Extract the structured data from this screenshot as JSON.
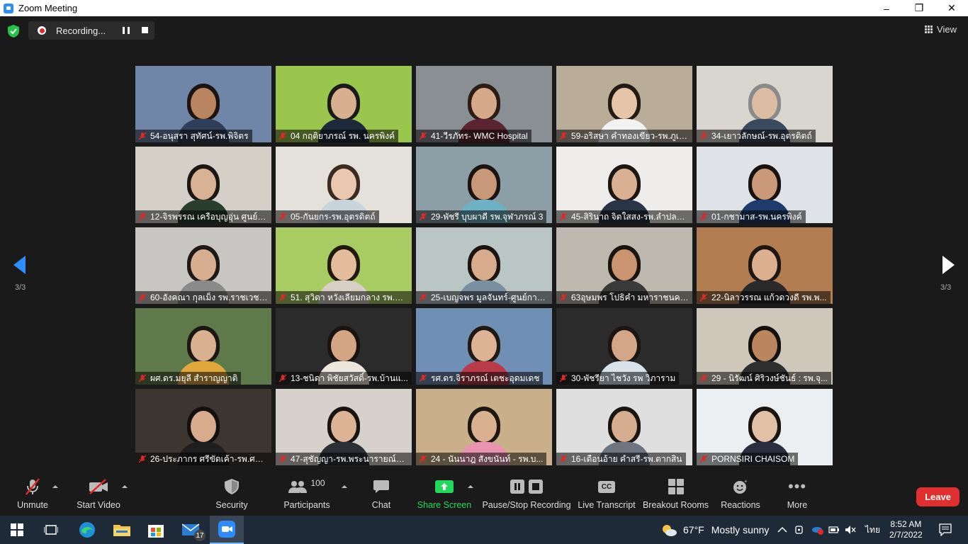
{
  "window": {
    "title": "Zoom Meeting"
  },
  "recording": {
    "status": "Recording..."
  },
  "view": {
    "label": "View"
  },
  "pagination": {
    "left": "3/3",
    "right": "3/3"
  },
  "participants_grid": [
    {
      "name": "54-อนุสรา สุทัศน์-รพ.พิจิตร",
      "bg": "#6f86a8",
      "skin": "#b98560",
      "hair": "#1c1410",
      "shirt": "#2f3e5a"
    },
    {
      "name": "04 กฤติยาภรณ์ รพ. นครพิงค์",
      "bg": "#9bc64e",
      "skin": "#d8b090",
      "hair": "#1a1a1a",
      "shirt": "#1e2a3a"
    },
    {
      "name": "41-วีรภัทร- WMC Hospital",
      "bg": "#8a8f94",
      "skin": "#d6a98a",
      "hair": "#2b1d16",
      "shirt": "#5a2430"
    },
    {
      "name": "59-อริสษา คำทองเขียว-รพ.ภูเขี...",
      "bg": "#b9ad9a",
      "skin": "#e6c4a8",
      "hair": "#241a14",
      "shirt": "#f2f2f2"
    },
    {
      "name": "34-เยาวลักษณ์-รพ.อุตรดิตถ์",
      "bg": "#d8d6cf",
      "skin": "#dcbca2",
      "hair": "#8a8a8a",
      "shirt": "#3a4a5e"
    },
    {
      "name": "12-จิรพรรณ เครือบุญอุ่น ศูนย์ส...",
      "bg": "#d4d0c8",
      "skin": "#d9b296",
      "hair": "#1b1613",
      "shirt": "#2a3e2e"
    },
    {
      "name": "05-กันยกร-รพ.อุตรดิตถ์",
      "bg": "#e4e0da",
      "skin": "#eac8b0",
      "hair": "#3a2a20",
      "shirt": "#c9d3dc"
    },
    {
      "name": "29-พัชรี บุบผาดี รพ.จุฬาภรณ์ 3",
      "bg": "#8c9fa6",
      "skin": "#c9987a",
      "hair": "#1a1410",
      "shirt": "#6fb1c4"
    },
    {
      "name": "45-สิรินาถ จิตใสสง-รพ.ลำปลาย...",
      "bg": "#eeedeb",
      "skin": "#d9b092",
      "hair": "#1c1511",
      "shirt": "#2a3447"
    },
    {
      "name": "01-กชามาส-รพ.นครพิงค์",
      "bg": "#dfe2e6",
      "skin": "#c9997a",
      "hair": "#17120f",
      "shirt": "#1d3b6c"
    },
    {
      "name": "60-อังคณา กุลเม็ง รพ.ราชเวชเ...",
      "bg": "#c8c6c2",
      "skin": "#d8ae90",
      "hair": "#1f1915",
      "shirt": "#8a8a8a"
    },
    {
      "name": "51. สุวิดา หวังเลียมกลาง รพ.กำ...",
      "bg": "#a9cc62",
      "skin": "#e3bc9c",
      "hair": "#22190f",
      "shirt": "#d8d0c4"
    },
    {
      "name": "25-เบญจพร มูลจันทร์-ศูนย์การ...",
      "bg": "#b9c6c4",
      "skin": "#d7ab8b",
      "hair": "#1c1410",
      "shirt": "#7a8fa0"
    },
    {
      "name": "63อุษมพร โปธิคำ มหาราชนครเ...",
      "bg": "#bdb9ae",
      "skin": "#c9946f",
      "hair": "#1a1410",
      "shirt": "#3a3a3a"
    },
    {
      "name": "22-นิลาวรรณ แก้วดวงดี รพ.พ...",
      "bg": "#b37d52",
      "skin": "#dcb08e",
      "hair": "#1e1712",
      "shirt": "#2a2a2a"
    },
    {
      "name": "ผศ.ดร.มยุลี สำราญญาติ",
      "bg": "#5f7a4a",
      "skin": "#d9b090",
      "hair": "#1d1712",
      "shirt": "#e0a73c"
    },
    {
      "name": "13-ชนิดา พิชัยสวัสดิ์-รพ.บ้านแ...",
      "bg": "#2b2b2b",
      "skin": "#d3a585",
      "hair": "#1a1411",
      "shirt": "#ede6dc"
    },
    {
      "name": "รศ.ดร.จิราภรณ์ เตชะอุดมเดช",
      "bg": "#6f8fb4",
      "skin": "#dcb394",
      "hair": "#201812",
      "shirt": "#b93a48"
    },
    {
      "name": "30-พัชรียา ไชวัง รพ วิภาราม",
      "bg": "#2b2b2b",
      "skin": "#d2a687",
      "hair": "#1c1512",
      "shirt": "#d8e2ea"
    },
    {
      "name": "29 - นิรัฒน์ ศิริวงษ์ชันธ์ : รพ.จุ...",
      "bg": "#cfc7ba",
      "skin": "#b98660",
      "hair": "#14100d",
      "shirt": "#2f2f2f"
    },
    {
      "name": "26-ประภากร ศรีขัดเค้า-รพ.ศรีน...",
      "bg": "#3d3530",
      "skin": "#d7ab8c",
      "hair": "#14100d",
      "shirt": "#1e1e1e"
    },
    {
      "name": "47-สุชัญญา-รพ.พระนารายณ์ม...",
      "bg": "#d6d2cb",
      "skin": "#dcb394",
      "hair": "#1a1410",
      "shirt": "#2d2f36"
    },
    {
      "name": "24 - นันนาฎ สังขนันท์ - รพ.บ...",
      "bg": "#c9b08a",
      "skin": "#d9b090",
      "hair": "#1e1712",
      "shirt": "#e894b0"
    },
    {
      "name": "16-เดือนอ้าย คำสรี-รพ.ตากสิน",
      "bg": "#dfdfe0",
      "skin": "#d6ad8e",
      "hair": "#1b1512",
      "shirt": "#6d7580"
    },
    {
      "name": "PORNSIRI CHAISOM",
      "bg": "#eceff2",
      "skin": "#e2c0a6",
      "hair": "#1a1410",
      "shirt": "#2a2e3e"
    }
  ],
  "toolbar": {
    "unmute": "Unmute",
    "start_video": "Start Video",
    "security": "Security",
    "participants": "Participants",
    "participants_count": "100",
    "chat": "Chat",
    "share_screen": "Share Screen",
    "pause_stop_recording": "Pause/Stop Recording",
    "live_transcript": "Live Transcript",
    "breakout_rooms": "Breakout Rooms",
    "reactions": "Reactions",
    "more": "More",
    "leave": "Leave",
    "cc_badge": "CC"
  },
  "taskbar": {
    "mail_badge": "17",
    "weather_temp": "67°F",
    "weather_text": "Mostly sunny",
    "language": "ไทย",
    "time": "8:52 AM",
    "date": "2/7/2022"
  },
  "colors": {
    "accent": "#2d8cff",
    "leave": "#e02f2f",
    "share": "#23d959",
    "muted": "#e02828"
  }
}
